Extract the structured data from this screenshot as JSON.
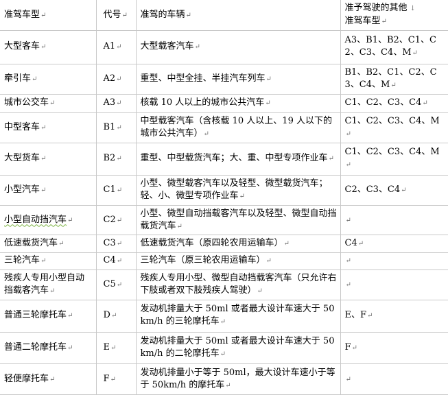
{
  "table": {
    "headers": {
      "type": "准驾车型",
      "code": "代号",
      "vehicles": "准驾的车辆",
      "other_line1": "准予驾驶的其他",
      "other_line2": "准驾车型"
    },
    "rows": [
      {
        "type": "大型客车",
        "code": "A1",
        "vehicles": "大型载客汽车",
        "other": "A3、B1、B2、C1、C2、C3、C4、M"
      },
      {
        "type": "牵引车",
        "code": "A2",
        "vehicles": "重型、中型全挂、半挂汽车列车",
        "other": "B1、B2、C1、C2、C3、C4、M"
      },
      {
        "type": "城市公交车",
        "code": "A3",
        "vehicles": "核载 10 人以上的城市公共汽车",
        "other": "C1、C2、C3、C4"
      },
      {
        "type": "中型客车",
        "code": "B1",
        "vehicles": "中型载客汽车（含核载 10 人以上、19 人以下的城市公共汽车）",
        "other": "C1、C2、C3、C4、M"
      },
      {
        "type": "大型货车",
        "code": "B2",
        "vehicles": "重型、中型载货汽车；大、重、中型专项作业车",
        "other": "C1、C2、C3、C4、M"
      },
      {
        "type": "小型汽车",
        "code": "C1",
        "vehicles": "小型、微型载客汽车以及轻型、微型载货汽车；轻、小、微型专项作业车",
        "other": "C2、C3、C4"
      },
      {
        "type": "小型自动挡汽车",
        "code": "C2",
        "vehicles": "小型、微型自动挡载客汽车以及轻型、微型自动挡载货汽车",
        "other": ""
      },
      {
        "type": "低速载货汽车",
        "code": "C3",
        "vehicles": "低速载货汽车（原四轮农用运输车）",
        "other": "C4"
      },
      {
        "type": "三轮汽车",
        "code": "C4",
        "vehicles": "三轮汽车（原三轮农用运输车）",
        "other": ""
      },
      {
        "type": "残疾人专用小型自动挡载客汽车",
        "code": "C5",
        "vehicles": "残疾人专用小型、微型自动挡载客汽车（只允许右下肢或者双下肢残疾人驾驶）",
        "other": ""
      },
      {
        "type": "普通三轮摩托车",
        "code": "D",
        "vehicles": "发动机排量大于 50ml 或者最大设计车速大于 50km/h 的三轮摩托车",
        "other": "E、F"
      },
      {
        "type": "普通二轮摩托车",
        "code": "E",
        "vehicles": "发动机排量大于 50ml 或者最大设计车速大于 50km/h 的二轮摩托车",
        "other": "F"
      },
      {
        "type": "轻便摩托车",
        "code": "F",
        "vehicles": "发动机排量小于等于 50ml，最大设计车速小于等于 50km/h 的摩托车",
        "other": ""
      }
    ]
  }
}
